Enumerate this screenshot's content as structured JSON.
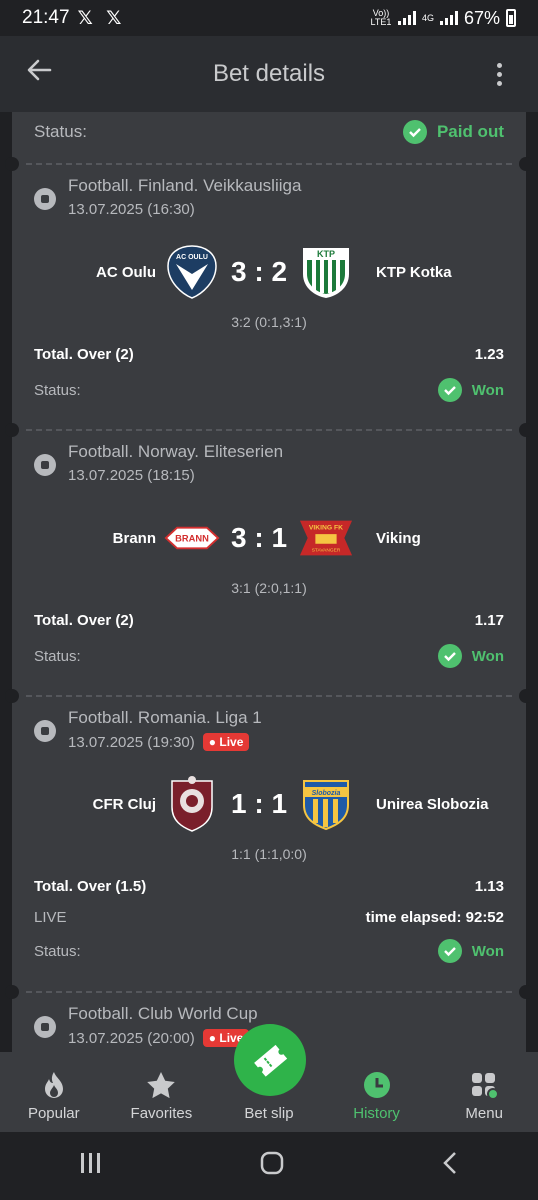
{
  "statusbar": {
    "time": "21:47",
    "x_icons": "𝕏 𝕏",
    "volte": "Vo)) LTE1",
    "network": "4G",
    "battery": "67%"
  },
  "appbar": {
    "title": "Bet details"
  },
  "summary": {
    "status_label": "Status:",
    "status_value": "Paid out"
  },
  "bets": [
    {
      "league": "Football. Finland. Veikkausliiga",
      "date": "13.07.2025 (16:30)",
      "live_badge": "",
      "home": "AC Oulu",
      "away": "KTP Kotka",
      "score": "3 : 2",
      "detail": "3:2 (0:1,3:1)",
      "market": "Total. Over (2)",
      "odds": "1.23",
      "status_label": "Status:",
      "status_value": "Won"
    },
    {
      "league": "Football. Norway. Eliteserien",
      "date": "13.07.2025 (18:15)",
      "live_badge": "",
      "home": "Brann",
      "away": "Viking",
      "score": "3 : 1",
      "detail": "3:1 (2:0,1:1)",
      "market": "Total. Over (2)",
      "odds": "1.17",
      "status_label": "Status:",
      "status_value": "Won"
    },
    {
      "league": "Football. Romania. Liga 1",
      "date": "13.07.2025 (19:30)",
      "live_badge": "Live",
      "home": "CFR Cluj",
      "away": "Unirea Slobozia",
      "score": "1 : 1",
      "detail": "1:1 (1:1,0:0)",
      "market": "Total. Over (1.5)",
      "odds": "1.13",
      "live_label": "LIVE",
      "elapsed": "time elapsed: 92:52",
      "status_label": "Status:",
      "status_value": "Won"
    },
    {
      "league": "Football. Club World Cup",
      "date": "13.07.2025 (20:00)",
      "live_badge": "Live"
    }
  ],
  "logos": {
    "ac_oulu": "AC OULU",
    "ktp": "KTP",
    "brann": "BRANN",
    "viking": "VIKING FK",
    "viking_sub": "STAVANGER",
    "slobozia": "Slobozia"
  },
  "nav": {
    "popular": "Popular",
    "favorites": "Favorites",
    "betslip": "Bet slip",
    "history": "History",
    "menu": "Menu"
  },
  "colors": {
    "accent": "#4fc16f",
    "live": "#e53935",
    "card": "#3a3c40"
  }
}
